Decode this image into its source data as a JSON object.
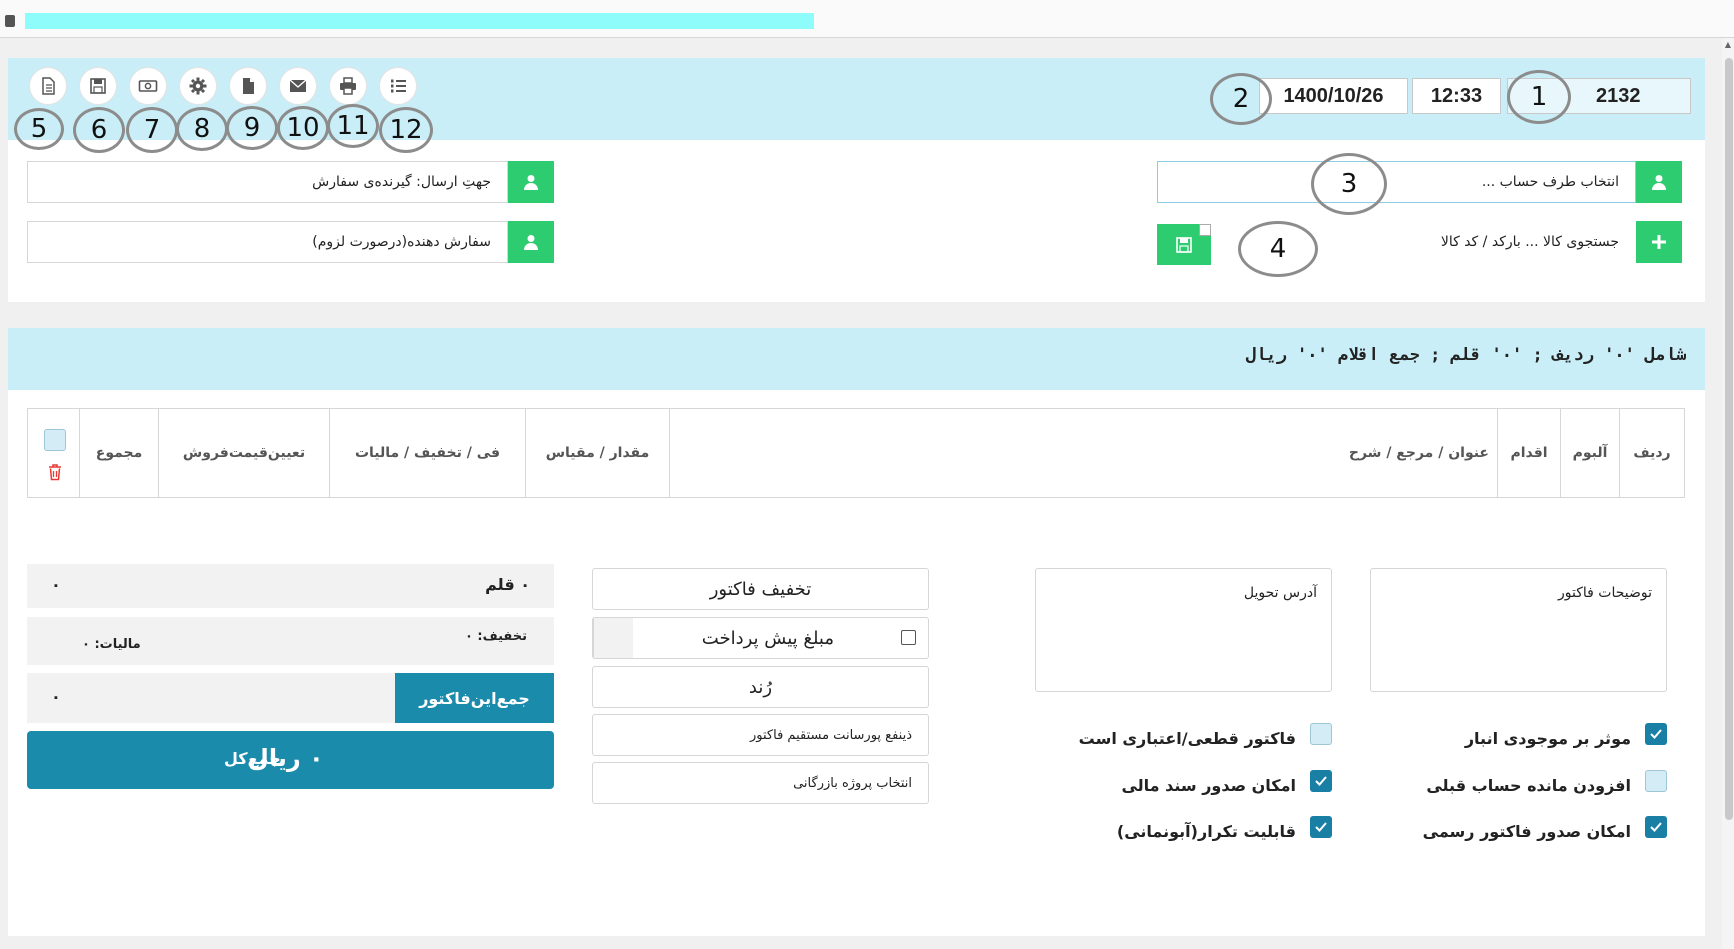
{
  "header": {
    "invoice_number": "2132",
    "time": "12:33",
    "date": "1400/10/26"
  },
  "toolbar": {
    "buttons": [
      "new-invoice-icon",
      "save-icon",
      "cash-icon",
      "settings-icon",
      "document-icon",
      "email-icon",
      "print-icon",
      "list-icon"
    ],
    "annotations": [
      "5",
      "6",
      "7",
      "8",
      "9",
      "10",
      "11",
      "12"
    ]
  },
  "annotations": {
    "a1": "1",
    "a2": "2",
    "a3": "3",
    "a4": "4"
  },
  "form": {
    "account_placeholder": "انتخاب طرف حساب ...",
    "product_search_placeholder": "جستجوی کالا ... بارکد / کد کالا",
    "ship_to": "جهتِ ارسال: گیرنده‌ی سفارش",
    "orderer": "سفارش دهنده(درصورت لزوم)"
  },
  "summary": "شامل '۰' ردیف ; '۰' قلم ; جمع اقلام '۰' ریال",
  "table": {
    "columns": [
      "ردیف",
      "آلبوم",
      "اقدام",
      "عنوان / مرجع / شرح",
      "مقدار / مقیاس",
      "فی / تخفیف / مالیات",
      "تعیین‌قیمت‌فروش",
      "مجموع"
    ]
  },
  "totals": {
    "items_label": "۰ قلم",
    "items_value": "۰",
    "discount_label": "تخفیف: ۰",
    "tax_label": "مالیات: ۰",
    "invoice_total_label": "جمع‌این‌فاکتور",
    "invoice_total_value": "۰",
    "grand_total_label": "جمع‌کل",
    "grand_total_value": "۰ ریال"
  },
  "actions": {
    "invoice_discount": "تخفیف فاکتور",
    "prepayment": "مبلغ پیش پرداخت",
    "round": "رُند",
    "commission": "ذینفع پورسانت مستقیم فاکتور",
    "project": "انتخاب پروژه بازرگانی"
  },
  "notes": {
    "delivery_address": "آدرس تحویل",
    "invoice_description": "توضیحات فاکتور"
  },
  "options": [
    {
      "label": "موثر بر موجودی انبار",
      "checked": true
    },
    {
      "label": "افزودن مانده حساب قبلی",
      "checked": false
    },
    {
      "label": "امکان صدور فاکتور رسمی",
      "checked": true
    },
    {
      "label": "فاکتور قطعی/اعتباری است",
      "checked": false
    },
    {
      "label": "امکان صدور سند مالی",
      "checked": true
    },
    {
      "label": "قابلیت تکرار(آبونمانی)",
      "checked": true
    }
  ],
  "colors": {
    "band": "#c9eef7",
    "green": "#2ecc71",
    "accent": "#1a7fa5",
    "danger": "#e53935"
  }
}
